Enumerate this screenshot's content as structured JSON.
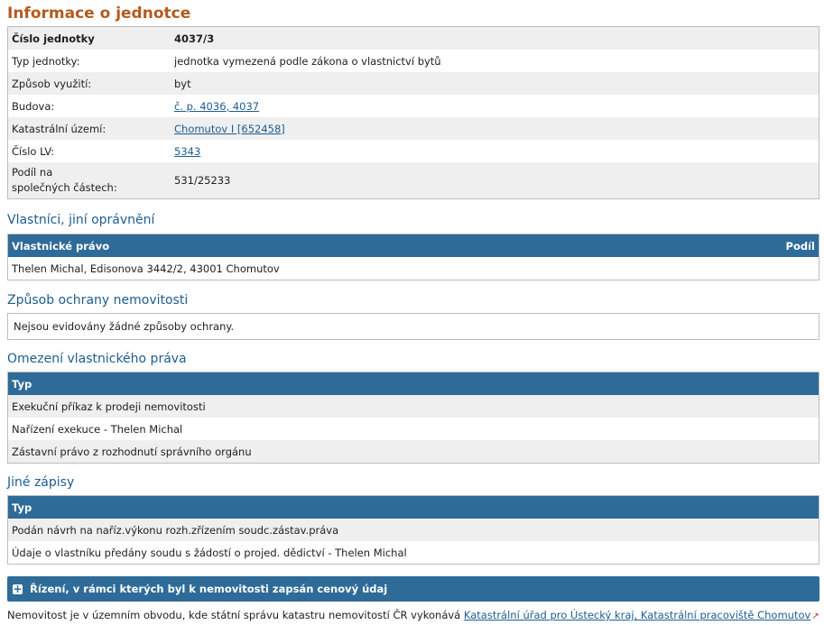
{
  "title": "Informace o jednotce",
  "info_rows": [
    {
      "label": "Číslo jednotky",
      "value": "4037/3"
    },
    {
      "label": "Typ jednotky:",
      "value": "jednotka vymezená podle zákona o vlastnictví bytů"
    },
    {
      "label": "Způsob využití:",
      "value": "byt"
    },
    {
      "label": "Budova:",
      "value": "č. p. 4036, 4037"
    },
    {
      "label": "Katastrální území:",
      "value": "Chomutov I [652458]"
    },
    {
      "label": "Číslo LV:",
      "value": "5343"
    },
    {
      "label_line1": "Podíl na",
      "label_line2": "společných částech:",
      "value": "531/25233"
    }
  ],
  "owners": {
    "heading": "Vlastníci, jiní oprávnění",
    "col_left": "Vlastnické právo",
    "col_right": "Podíl",
    "rows": [
      "Thelen Michal, Edisonova 3442/2, 43001 Chomutov"
    ]
  },
  "protection": {
    "heading": "Způsob ochrany nemovitosti",
    "text": "Nejsou evidovány žádné způsoby ochrany."
  },
  "restrictions": {
    "heading": "Omezení vlastnického práva",
    "col": "Typ",
    "rows": [
      "Exekuční příkaz k prodeji nemovitosti",
      "Nařízení exekuce - Thelen Michal",
      "Zástavní právo z rozhodnutí správního orgánu"
    ]
  },
  "other": {
    "heading": "Jiné zápisy",
    "col": "Typ",
    "rows": [
      "Podán návrh na naříz.výkonu rozh.zřízením soudc.zástav.práva",
      "Údaje o vlastníku předány soudu s žádostí o projed. dědictví - Thelen Michal"
    ]
  },
  "proceedings_bar": {
    "icon": "plus-icon",
    "label": "Řízení, v rámci kterých byl k nemovitosti zapsán cenový údaj"
  },
  "footer": {
    "text": "Nemovitost je v územním obvodu, kde státní správu katastru nemovitostí ČR vykonává ",
    "link": "Katastrální úřad pro Ústecký kraj, Katastrální pracoviště Chomutov",
    "icon": "external-link-icon"
  },
  "colors": {
    "title": "#b35a1f",
    "heading": "#1d5d8f",
    "table_header": "#2e6b98",
    "row_alt": "#efefef"
  }
}
